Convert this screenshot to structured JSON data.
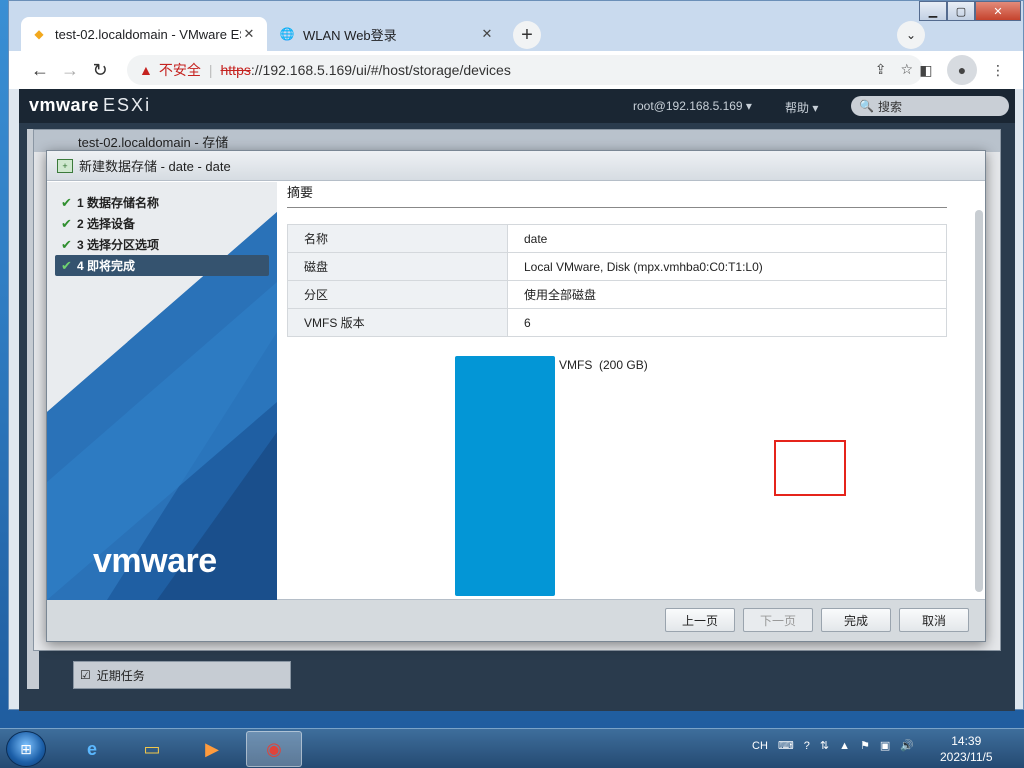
{
  "browser": {
    "tabs": [
      {
        "title": "test-02.localdomain - VMware ESXi",
        "icon": "vmware-favicon"
      },
      {
        "title": "WLAN Web登录",
        "icon": "globe-icon"
      }
    ],
    "security_warning": "不安全",
    "url_scheme": "https",
    "url_rest": "://192.168.5.169/ui/#/host/storage/devices"
  },
  "esxi": {
    "logo_brand": "vm",
    "logo_suffix": "ware",
    "logo_product": "ESXi",
    "user": "root@192.168.5.169 ▾",
    "help": "帮助 ▾",
    "search_placeholder": "搜索",
    "panel_title": "test-02.localdomain - 存储",
    "recent_tasks": "近期任务"
  },
  "dialog": {
    "title": "新建数据存储 - date - date",
    "steps": [
      {
        "label": "1 数据存储名称",
        "done": true
      },
      {
        "label": "2 选择设备",
        "done": true
      },
      {
        "label": "3 选择分区选项",
        "done": true
      },
      {
        "label": "4 即将完成",
        "done": true,
        "active": true
      }
    ],
    "brand_logo": "vmware",
    "summary_title": "摘要",
    "summary_rows": [
      {
        "key": "名称",
        "value": "date"
      },
      {
        "key": "磁盘",
        "value": "Local VMware, Disk (mpx.vmhba0:C0:T1:L0)"
      },
      {
        "key": "分区",
        "value": "使用全部磁盘"
      },
      {
        "key": "VMFS 版本",
        "value": "6"
      }
    ],
    "partition_label": "VMFS  (200 GB)",
    "partition_color": "#0396d6",
    "buttons": {
      "prev": "上一页",
      "next": "下一页",
      "finish": "完成",
      "cancel": "取消"
    }
  },
  "taskbar": {
    "ime": "CH",
    "time": "14:39",
    "date": "2023/11/5"
  },
  "colors": {
    "accent": "#35536f",
    "highlight": "#e5241b"
  }
}
